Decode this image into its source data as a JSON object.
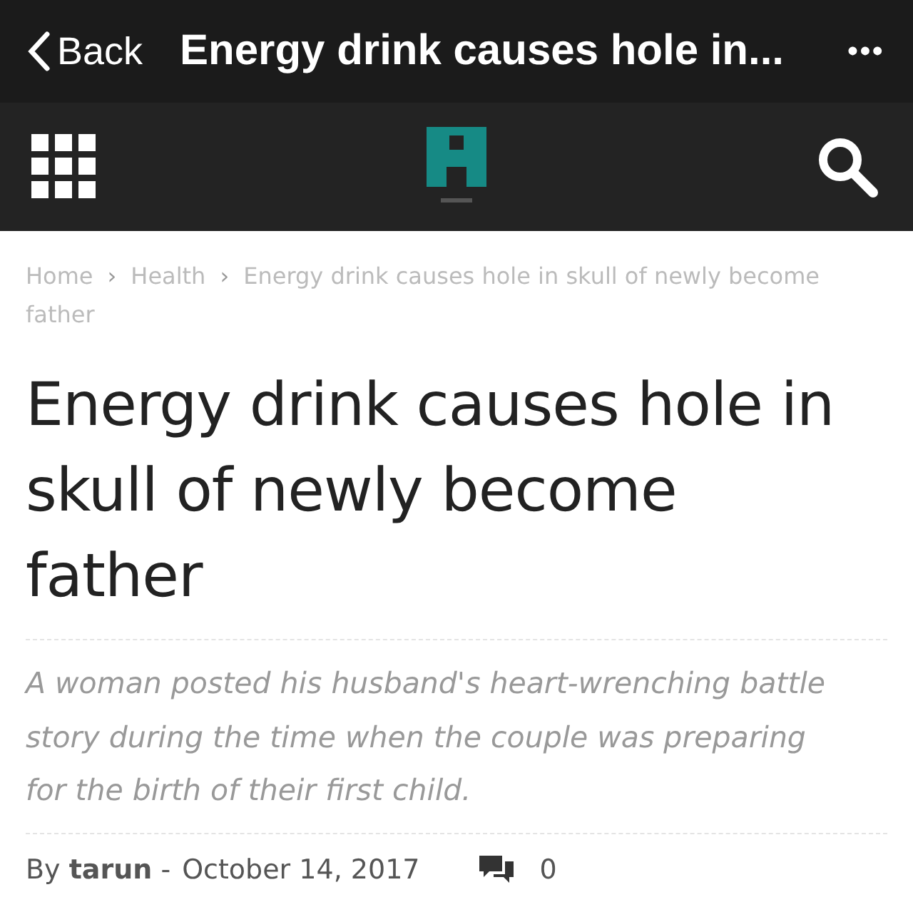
{
  "top_bar": {
    "back": "Back",
    "title": "Energy drink causes hole in...",
    "more": "•••"
  },
  "breadcrumb": [
    {
      "label": "Home"
    },
    {
      "label": "Health"
    },
    {
      "label": "Energy drink causes hole in skull of newly become father"
    }
  ],
  "breadcrumb_separator": "›",
  "article": {
    "title": "Energy drink causes hole in skull of newly become father",
    "excerpt": "A woman posted his husband's heart-wrenching battle story during the time when the couple was preparing for the birth of their first child.",
    "byline": "By **tarun** -",
    "date": "October 14, 2017",
    "comments": "0"
  }
}
